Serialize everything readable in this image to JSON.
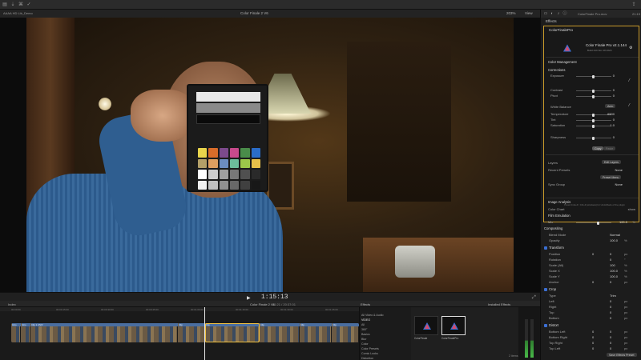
{
  "topbar": {
    "library_label": "AAAA HD Lib_Demo"
  },
  "viewer": {
    "title": "Color Finale 2 V6",
    "zoom": "203%",
    "view_menu": "View"
  },
  "transport": {
    "timecode": "1:15:13"
  },
  "timeline": {
    "index_label": "Index",
    "project_name": "Color Finale 2 V6",
    "duration": "01:21 / 20:37:01",
    "ruler_marks": [
      "00:00:00",
      "00:00:15:00",
      "00:00:30:00",
      "00:00:45:00",
      "00:01:00:00",
      "00:01:15:00",
      "00:01:30:00",
      "00:01:45:00"
    ],
    "clips": [
      "Intro",
      "Intro",
      "Clip 1 UNIV",
      "Clip",
      "Clip",
      "Clip",
      "Clip",
      "Clip"
    ]
  },
  "browser": {
    "effects_label": "Effects",
    "installed_label": "Installed Effects",
    "categories": [
      "All Video & Audio",
      "VIDEO",
      "All",
      "360°",
      "Basics",
      "Blur",
      "Color",
      "Color Presets",
      "Comic Looks",
      "Distortion"
    ],
    "items": [
      "ColorFinale",
      "ColorFinalePro"
    ],
    "count": "2 items"
  },
  "inspector": {
    "file": "ColorFinale Pro.mov",
    "time": "21:19",
    "effects_heading": "Effects",
    "plugin_name": "ColorFinalePro",
    "cfp_title": "Color Finale Pro v2.1.144",
    "cfp_sub": "Build 444 Nov 18 2020",
    "color_management": "Color Management",
    "corrections": "Corrections",
    "exposure": {
      "label": "Exposure",
      "value": "0"
    },
    "contrast": {
      "label": "Contrast",
      "value": "0"
    },
    "pivot": {
      "label": "Pivot",
      "value": "0"
    },
    "white_balance": {
      "label": "White Balance",
      "auto": "Auto"
    },
    "temperature": {
      "label": "Temperature",
      "value": "6500"
    },
    "tint": {
      "label": "Tint",
      "value": "0"
    },
    "saturation": {
      "label": "Saturation",
      "value": "1.0"
    },
    "sharpness": {
      "label": "Sharpness",
      "value": "0"
    },
    "copy_btn": "Copy",
    "paste_btn": "Paste",
    "layers": {
      "label": "Layers",
      "btn": "Edit Layers"
    },
    "recent_presets": {
      "label": "Recent Presets",
      "value": "None"
    },
    "preset_menu_btn": "Preset Menu",
    "sync_group": {
      "label": "Sync Group",
      "value": "None"
    },
    "help_text": "Press Cmd+Z / Ctrl+Z (windows) for Undo/Redo of the plugin",
    "image_analysis": "Image Analysis",
    "color_chart": {
      "label": "Color Chart",
      "action": "show"
    },
    "film_emulation": "Film Emulation",
    "mix": {
      "label": "Mix",
      "value": "100.0",
      "unit": "%"
    },
    "compositing": "Compositing",
    "blend_mode": {
      "label": "Blend Mode",
      "value": "Normal"
    },
    "opacity": {
      "label": "Opacity",
      "value": "100.0",
      "unit": "%"
    },
    "transform": "Transform",
    "position": {
      "label": "Position",
      "x": "0",
      "y": "0",
      "unit": "px"
    },
    "rotation": {
      "label": "Rotation",
      "value": "0",
      "unit": "°"
    },
    "scale_all": {
      "label": "Scale (All)",
      "value": "100",
      "unit": "%"
    },
    "scale_x": {
      "label": "Scale X",
      "value": "100.0",
      "unit": "%"
    },
    "scale_y": {
      "label": "Scale Y",
      "value": "100.0",
      "unit": "%"
    },
    "anchor": {
      "label": "Anchor",
      "x": "0",
      "y": "0",
      "unit": "px"
    },
    "crop": "Crop",
    "type": {
      "label": "Type",
      "value": "Trim"
    },
    "left": {
      "label": "Left",
      "value": "0",
      "unit": "px"
    },
    "right": {
      "label": "Right",
      "value": "0",
      "unit": "px"
    },
    "top": {
      "label": "Top",
      "value": "0",
      "unit": "px"
    },
    "bottom": {
      "label": "Bottom",
      "value": "0",
      "unit": "px"
    },
    "distort": "Distort",
    "bottom_left": {
      "label": "Bottom Left",
      "x": "0",
      "y": "0",
      "unit": "px"
    },
    "bottom_right": {
      "label": "Bottom Right",
      "x": "0",
      "y": "0",
      "unit": "px"
    },
    "top_right": {
      "label": "Top Right",
      "x": "0",
      "y": "0",
      "unit": "px"
    },
    "top_left": {
      "label": "Top Left",
      "x": "0",
      "y": "0",
      "unit": "px"
    },
    "save_preset": "Save Effects Preset"
  },
  "colors": {
    "accent": "#c89a2a",
    "clip": "#4a6ea0",
    "checkbox": "#3b6fd4"
  }
}
